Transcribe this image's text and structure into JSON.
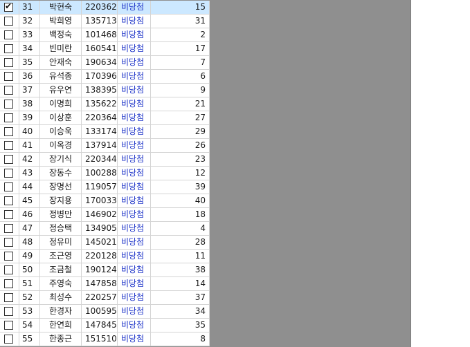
{
  "table": {
    "rows": [
      {
        "checked": true,
        "num": "31",
        "name": "박현숙",
        "id": "220362",
        "status": "비당첨",
        "count": "15"
      },
      {
        "checked": false,
        "num": "32",
        "name": "박희영",
        "id": "135713",
        "status": "비당첨",
        "count": "31"
      },
      {
        "checked": false,
        "num": "33",
        "name": "백정숙",
        "id": "101468",
        "status": "비당첨",
        "count": "2"
      },
      {
        "checked": false,
        "num": "34",
        "name": "빈미란",
        "id": "160541",
        "status": "비당첨",
        "count": "17"
      },
      {
        "checked": false,
        "num": "35",
        "name": "안재숙",
        "id": "190634",
        "status": "비당첨",
        "count": "7"
      },
      {
        "checked": false,
        "num": "36",
        "name": "유석종",
        "id": "170396",
        "status": "비당첨",
        "count": "6"
      },
      {
        "checked": false,
        "num": "37",
        "name": "유우연",
        "id": "138395",
        "status": "비당첨",
        "count": "9"
      },
      {
        "checked": false,
        "num": "38",
        "name": "이명희",
        "id": "135622",
        "status": "비당첨",
        "count": "21"
      },
      {
        "checked": false,
        "num": "39",
        "name": "이상훈",
        "id": "220364",
        "status": "비당첨",
        "count": "27"
      },
      {
        "checked": false,
        "num": "40",
        "name": "이승욱",
        "id": "133174",
        "status": "비당첨",
        "count": "29"
      },
      {
        "checked": false,
        "num": "41",
        "name": "이옥경",
        "id": "137914",
        "status": "비당첨",
        "count": "26"
      },
      {
        "checked": false,
        "num": "42",
        "name": "장기식",
        "id": "220344",
        "status": "비당첨",
        "count": "23"
      },
      {
        "checked": false,
        "num": "43",
        "name": "장동수",
        "id": "100288",
        "status": "비당첨",
        "count": "12"
      },
      {
        "checked": false,
        "num": "44",
        "name": "장명선",
        "id": "119057",
        "status": "비당첨",
        "count": "39"
      },
      {
        "checked": false,
        "num": "45",
        "name": "장지용",
        "id": "170033",
        "status": "비당첨",
        "count": "40"
      },
      {
        "checked": false,
        "num": "46",
        "name": "정병만",
        "id": "146902",
        "status": "비당첨",
        "count": "18"
      },
      {
        "checked": false,
        "num": "47",
        "name": "정승택",
        "id": "134905",
        "status": "비당첨",
        "count": "4"
      },
      {
        "checked": false,
        "num": "48",
        "name": "정유미",
        "id": "145021",
        "status": "비당첨",
        "count": "28"
      },
      {
        "checked": false,
        "num": "49",
        "name": "조근영",
        "id": "220128",
        "status": "비당첨",
        "count": "11"
      },
      {
        "checked": false,
        "num": "50",
        "name": "조금철",
        "id": "190124",
        "status": "비당첨",
        "count": "38"
      },
      {
        "checked": false,
        "num": "51",
        "name": "주영숙",
        "id": "147858",
        "status": "비당첨",
        "count": "14"
      },
      {
        "checked": false,
        "num": "52",
        "name": "최성수",
        "id": "220257",
        "status": "비당첨",
        "count": "37"
      },
      {
        "checked": false,
        "num": "53",
        "name": "한경자",
        "id": "100595",
        "status": "비당첨",
        "count": "34"
      },
      {
        "checked": false,
        "num": "54",
        "name": "한연희",
        "id": "147845",
        "status": "비당첨",
        "count": "35"
      },
      {
        "checked": false,
        "num": "55",
        "name": "한종근",
        "id": "151510",
        "status": "비당첨",
        "count": "8"
      }
    ]
  },
  "colors": {
    "status_text": "#1f35c9",
    "selected_row": "#cce8ff",
    "empty_area": "#8f8f8f"
  }
}
